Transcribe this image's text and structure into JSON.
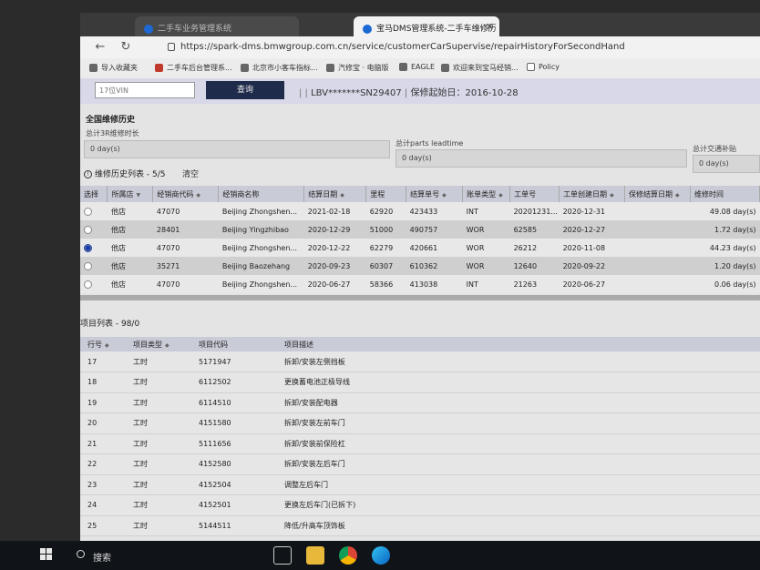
{
  "browser": {
    "inactive_tab": "二手车业务管理系统",
    "active_tab": "宝马DMS管理系统-二手车维修历",
    "url": "https://spark-dms.bmwgroup.com.cn/service/customerCarSupervise/repairHistoryForSecondHand",
    "bookmarks": [
      "导入收藏夹",
      "二手车后台管理系...",
      "北京市小客车指标...",
      "汽修宝 · 电脑版",
      "EAGLE",
      "欢迎来到宝马经销...",
      "Policy"
    ]
  },
  "search": {
    "vin_placeholder": "17位VIN",
    "query_label": "查询",
    "vin_value": "LBV*******SN29407",
    "warranty_label": "保修起始日：2016-10-28"
  },
  "summary": {
    "title": "全国维修历史",
    "total_3r_label": "总计3R维修时长",
    "total_3r_value": "0 day(s)",
    "parts_label": "总计parts leadtime",
    "parts_value": "0 day(s)",
    "transport_label": "总计交通补贴",
    "transport_value": "0 day(s)"
  },
  "history": {
    "header": "维修历史列表 - 5/5",
    "clear_label": "清空",
    "columns": [
      "选择",
      "所属店",
      "经销商代码",
      "经销商名称",
      "结算日期",
      "里程",
      "结算单号",
      "账单类型",
      "工单号",
      "工单创建日期",
      "保修结算日期",
      "维修时间"
    ],
    "rows": [
      {
        "store": "他店",
        "code": "47070",
        "name": "Beijing Zhongshen...",
        "date": "2021-02-18",
        "mileage": "62920",
        "no": "423433",
        "type": "INT",
        "order": "20201231...",
        "created": "2020-12-31",
        "warranty": "",
        "time": "49.08 day(s)"
      },
      {
        "store": "他店",
        "code": "28401",
        "name": "Beijing Yingzhibao",
        "date": "2020-12-29",
        "mileage": "51000",
        "no": "490757",
        "type": "WOR",
        "order": "62585",
        "created": "2020-12-27",
        "warranty": "",
        "time": "1.72 day(s)"
      },
      {
        "store": "他店",
        "code": "47070",
        "name": "Beijing Zhongshen...",
        "date": "2020-12-22",
        "mileage": "62279",
        "no": "420661",
        "type": "WOR",
        "order": "26212",
        "created": "2020-11-08",
        "warranty": "",
        "time": "44.23 day(s)"
      },
      {
        "store": "他店",
        "code": "35271",
        "name": "Beijing Baozehang",
        "date": "2020-09-23",
        "mileage": "60307",
        "no": "610362",
        "type": "WOR",
        "order": "12640",
        "created": "2020-09-22",
        "warranty": "",
        "time": "1.20 day(s)"
      },
      {
        "store": "他店",
        "code": "47070",
        "name": "Beijing Zhongshen...",
        "date": "2020-06-27",
        "mileage": "58366",
        "no": "413038",
        "type": "INT",
        "order": "21263",
        "created": "2020-06-27",
        "warranty": "",
        "time": "0.06 day(s)"
      }
    ]
  },
  "items": {
    "header": "项目列表 - 98/0",
    "columns": [
      "行号",
      "项目类型",
      "项目代码",
      "项目描述"
    ],
    "rows": [
      {
        "line": "17",
        "type": "工时",
        "code": "5171947",
        "desc": "拆卸/安装左侧挡板"
      },
      {
        "line": "18",
        "type": "工时",
        "code": "6112502",
        "desc": "更换蓄电池正极导线"
      },
      {
        "line": "19",
        "type": "工时",
        "code": "6114510",
        "desc": "拆卸/安装配电器"
      },
      {
        "line": "20",
        "type": "工时",
        "code": "4151580",
        "desc": "拆卸/安装左前车门"
      },
      {
        "line": "21",
        "type": "工时",
        "code": "5111656",
        "desc": "拆卸/安装前保险杠"
      },
      {
        "line": "22",
        "type": "工时",
        "code": "4152580",
        "desc": "拆卸/安装左后车门"
      },
      {
        "line": "23",
        "type": "工时",
        "code": "4152504",
        "desc": "调整左后车门"
      },
      {
        "line": "24",
        "type": "工时",
        "code": "4152501",
        "desc": "更换左后车门(已拆下)"
      },
      {
        "line": "25",
        "type": "工时",
        "code": "5144511",
        "desc": "降低/升高车顶饰板"
      }
    ]
  },
  "taskbar": {
    "search_label": "搜索"
  }
}
